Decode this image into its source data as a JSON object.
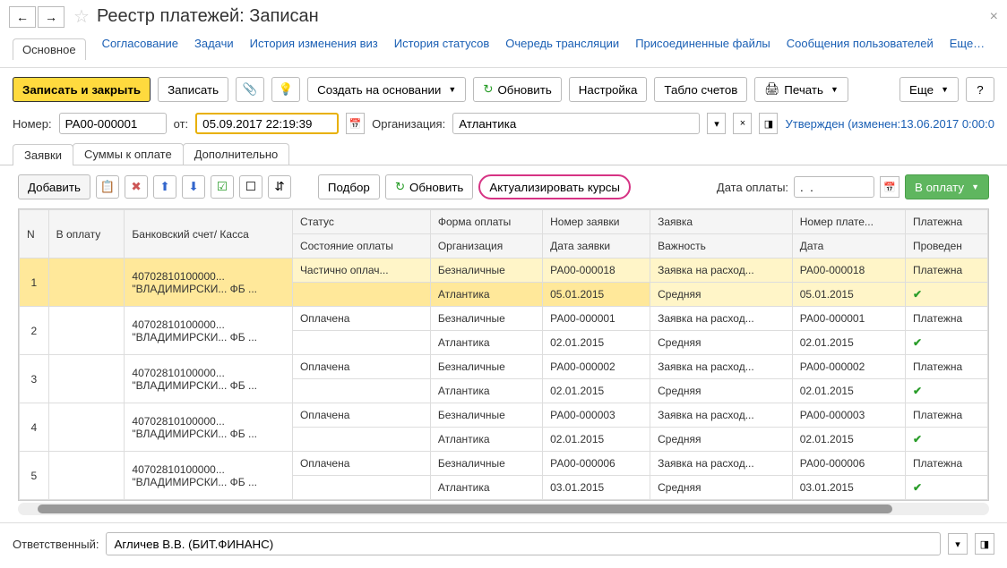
{
  "title": "Реестр платежей: Записан",
  "topnav": [
    "Основное",
    "Согласование",
    "Задачи",
    "История изменения виз",
    "История статусов",
    "Очередь трансляции",
    "Присоединенные файлы",
    "Сообщения пользователей",
    "Еще…"
  ],
  "toolbar": {
    "save_close": "Записать и закрыть",
    "save": "Записать",
    "create_based": "Создать на основании",
    "refresh": "Обновить",
    "settings": "Настройка",
    "accounts": "Табло счетов",
    "print": "Печать",
    "more": "Еще",
    "help": "?"
  },
  "fields": {
    "number_label": "Номер:",
    "number_value": "РА00-000001",
    "from_label": "от:",
    "date_value": "05.09.2017 22:19:39",
    "org_label": "Организация:",
    "org_value": "Атлантика",
    "status_link": "Утвержден (изменен:13.06.2017 0:00:0"
  },
  "tabs2": [
    "Заявки",
    "Суммы к оплате",
    "Дополнительно"
  ],
  "sub": {
    "add": "Добавить",
    "pick": "Подбор",
    "refresh": "Обновить",
    "rates": "Актуализировать курсы",
    "pay_date": "Дата оплаты:",
    "pay_date_value": ".  .",
    "to_pay": "В оплату"
  },
  "headers_top": [
    "N",
    "В оплату",
    "Банковский счет/ Касса",
    "Статус",
    "Форма оплаты",
    "Номер заявки",
    "Заявка",
    "Номер плате...",
    "Платежна"
  ],
  "headers_bot": [
    "",
    "",
    "",
    "Состояние оплаты",
    "Организация",
    "Дата заявки",
    "Важность",
    "Дата",
    "Проведен"
  ],
  "rows": [
    {
      "n": "1",
      "acct": "40702810100000... \"ВЛАДИМИРСКИ... ФБ ...",
      "status": "Частично оплач...",
      "state": "",
      "form": "Безналичные",
      "org": "Атлантика",
      "req_no": "РА00-000018",
      "req_date": "05.01.2015",
      "req": "Заявка на расход...",
      "imp": "Средняя",
      "pay_no": "РА00-000018",
      "pay_date": "05.01.2015",
      "pay": "Платежна",
      "done": true,
      "sel": true
    },
    {
      "n": "2",
      "acct": "40702810100000... \"ВЛАДИМИРСКИ... ФБ ...",
      "status": "Оплачена",
      "state": "",
      "form": "Безналичные",
      "org": "Атлантика",
      "req_no": "РА00-000001",
      "req_date": "02.01.2015",
      "req": "Заявка на расход...",
      "imp": "Средняя",
      "pay_no": "РА00-000001",
      "pay_date": "02.01.2015",
      "pay": "Платежна",
      "done": true
    },
    {
      "n": "3",
      "acct": "40702810100000... \"ВЛАДИМИРСКИ... ФБ ...",
      "status": "Оплачена",
      "state": "",
      "form": "Безналичные",
      "org": "Атлантика",
      "req_no": "РА00-000002",
      "req_date": "02.01.2015",
      "req": "Заявка на расход...",
      "imp": "Средняя",
      "pay_no": "РА00-000002",
      "pay_date": "02.01.2015",
      "pay": "Платежна",
      "done": true
    },
    {
      "n": "4",
      "acct": "40702810100000... \"ВЛАДИМИРСКИ... ФБ ...",
      "status": "Оплачена",
      "state": "",
      "form": "Безналичные",
      "org": "Атлантика",
      "req_no": "РА00-000003",
      "req_date": "02.01.2015",
      "req": "Заявка на расход...",
      "imp": "Средняя",
      "pay_no": "РА00-000003",
      "pay_date": "02.01.2015",
      "pay": "Платежна",
      "done": true
    },
    {
      "n": "5",
      "acct": "40702810100000... \"ВЛАДИМИРСКИ... ФБ ...",
      "status": "Оплачена",
      "state": "",
      "form": "Безналичные",
      "org": "Атлантика",
      "req_no": "РА00-000006",
      "req_date": "03.01.2015",
      "req": "Заявка на расход...",
      "imp": "Средняя",
      "pay_no": "РА00-000006",
      "pay_date": "03.01.2015",
      "pay": "Платежна",
      "done": true
    }
  ],
  "footer": {
    "label": "Ответственный:",
    "value": "Агличев В.В. (БИТ.ФИНАНС)"
  }
}
